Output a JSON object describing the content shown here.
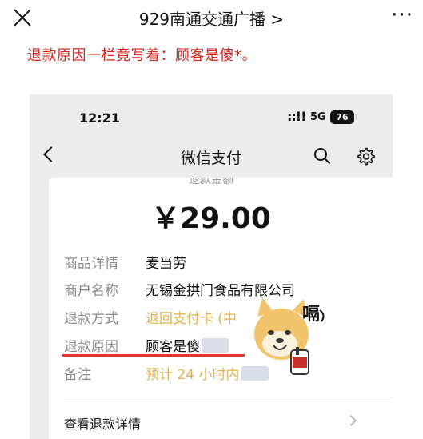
{
  "topbar": {
    "account_name": "929南通交通广播 >",
    "more_label": "···"
  },
  "headline": "退款原因一栏竟写着：顾客是傻*。",
  "screenshot": {
    "status_bar": {
      "time": "12:21",
      "signal": "::!!",
      "network": "5G",
      "battery": "76"
    },
    "nav": {
      "title": "微信支付"
    },
    "refund": {
      "cut_label": "退款金额",
      "amount": "￥29.00",
      "rows": [
        {
          "key": "商品详情",
          "value": "麦当劳"
        },
        {
          "key": "商户名称",
          "value": "无锡金拱门食品有限公司"
        },
        {
          "key": "退款方式",
          "value": "退回支付卡 (中"
        },
        {
          "key": "退款原因",
          "value": "顾客是傻"
        },
        {
          "key": "备注",
          "value": "预计 24 小时内"
        }
      ],
      "detail_label": "查看退款详情"
    },
    "sticker": {
      "caption": "嗝"
    }
  }
}
